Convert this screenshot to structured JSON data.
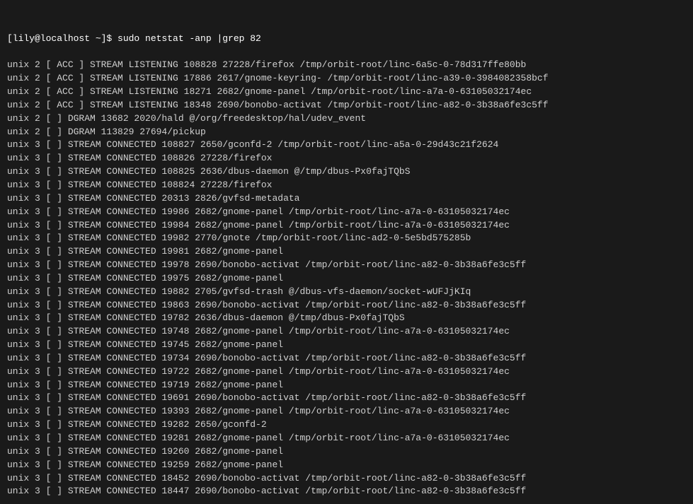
{
  "terminal": {
    "prompt": "[lily@localhost ~]$ sudo netstat -anp |grep 82",
    "rows": [
      {
        "proto": "unix",
        "refcnt": "2",
        "flags": "[ ACC ]",
        "type": "STREAM",
        "state": "LISTENING",
        "inode": "108828",
        "pid_prog": "27228/firefox",
        "path": "/tmp/orbit-root/linc-6a5c-0-78d317ffe80bb"
      },
      {
        "proto": "unix",
        "refcnt": "2",
        "flags": "[ ACC ]",
        "type": "STREAM",
        "state": "LISTENING",
        "inode": "17886",
        "pid_prog": "2617/gnome-keyring-",
        "path": "/tmp/orbit-root/linc-a39-0-3984082358bcf"
      },
      {
        "proto": "unix",
        "refcnt": "2",
        "flags": "[ ACC ]",
        "type": "STREAM",
        "state": "LISTENING",
        "inode": "18271",
        "pid_prog": "2682/gnome-panel",
        "path": "/tmp/orbit-root/linc-a7a-0-63105032174ec"
      },
      {
        "proto": "unix",
        "refcnt": "2",
        "flags": "[ ACC ]",
        "type": "STREAM",
        "state": "LISTENING",
        "inode": "18348",
        "pid_prog": "2690/bonobo-activat",
        "path": "/tmp/orbit-root/linc-a82-0-3b38a6fe3c5ff"
      },
      {
        "proto": "unix",
        "refcnt": "2",
        "flags": "[  ]",
        "type": "DGRAM",
        "state": "",
        "inode": "13682",
        "pid_prog": "2020/hald",
        "path": "@/org/freedesktop/hal/udev_event"
      },
      {
        "proto": "unix",
        "refcnt": "2",
        "flags": "[  ]",
        "type": "DGRAM",
        "state": "",
        "inode": "113829",
        "pid_prog": "27694/pickup",
        "path": ""
      },
      {
        "proto": "unix",
        "refcnt": "3",
        "flags": "[  ]",
        "type": "STREAM",
        "state": "CONNECTED",
        "inode": "108827",
        "pid_prog": "2650/gconfd-2",
        "path": "/tmp/orbit-root/linc-a5a-0-29d43c21f2624"
      },
      {
        "proto": "unix",
        "refcnt": "3",
        "flags": "[  ]",
        "type": "STREAM",
        "state": "CONNECTED",
        "inode": "108826",
        "pid_prog": "27228/firefox",
        "path": ""
      },
      {
        "proto": "unix",
        "refcnt": "3",
        "flags": "[  ]",
        "type": "STREAM",
        "state": "CONNECTED",
        "inode": "108825",
        "pid_prog": "2636/dbus-daemon",
        "path": "@/tmp/dbus-Px0fajTQbS"
      },
      {
        "proto": "unix",
        "refcnt": "3",
        "flags": "[  ]",
        "type": "STREAM",
        "state": "CONNECTED",
        "inode": "108824",
        "pid_prog": "27228/firefox",
        "path": ""
      },
      {
        "proto": "unix",
        "refcnt": "3",
        "flags": "[  ]",
        "type": "STREAM",
        "state": "CONNECTED",
        "inode": "20313",
        "pid_prog": "2826/gvfsd-metadata",
        "path": ""
      },
      {
        "proto": "unix",
        "refcnt": "3",
        "flags": "[  ]",
        "type": "STREAM",
        "state": "CONNECTED",
        "inode": "19986",
        "pid_prog": "2682/gnome-panel",
        "path": "/tmp/orbit-root/linc-a7a-0-63105032174ec"
      },
      {
        "proto": "unix",
        "refcnt": "3",
        "flags": "[  ]",
        "type": "STREAM",
        "state": "CONNECTED",
        "inode": "19984",
        "pid_prog": "2682/gnome-panel",
        "path": "/tmp/orbit-root/linc-a7a-0-63105032174ec"
      },
      {
        "proto": "unix",
        "refcnt": "3",
        "flags": "[  ]",
        "type": "STREAM",
        "state": "CONNECTED",
        "inode": "19982",
        "pid_prog": "2770/gnote",
        "path": "/tmp/orbit-root/linc-ad2-0-5e5bd575285b"
      },
      {
        "proto": "unix",
        "refcnt": "3",
        "flags": "[  ]",
        "type": "STREAM",
        "state": "CONNECTED",
        "inode": "19981",
        "pid_prog": "2682/gnome-panel",
        "path": ""
      },
      {
        "proto": "unix",
        "refcnt": "3",
        "flags": "[  ]",
        "type": "STREAM",
        "state": "CONNECTED",
        "inode": "19978",
        "pid_prog": "2690/bonobo-activat",
        "path": "/tmp/orbit-root/linc-a82-0-3b38a6fe3c5ff"
      },
      {
        "proto": "unix",
        "refcnt": "3",
        "flags": "[  ]",
        "type": "STREAM",
        "state": "CONNECTED",
        "inode": "19975",
        "pid_prog": "2682/gnome-panel",
        "path": ""
      },
      {
        "proto": "unix",
        "refcnt": "3",
        "flags": "[  ]",
        "type": "STREAM",
        "state": "CONNECTED",
        "inode": "19882",
        "pid_prog": "2705/gvfsd-trash",
        "path": "@/dbus-vfs-daemon/socket-wUFJjKIq"
      },
      {
        "proto": "unix",
        "refcnt": "3",
        "flags": "[  ]",
        "type": "STREAM",
        "state": "CONNECTED",
        "inode": "19863",
        "pid_prog": "2690/bonobo-activat",
        "path": "/tmp/orbit-root/linc-a82-0-3b38a6fe3c5ff"
      },
      {
        "proto": "unix",
        "refcnt": "3",
        "flags": "[  ]",
        "type": "STREAM",
        "state": "CONNECTED",
        "inode": "19782",
        "pid_prog": "2636/dbus-daemon",
        "path": "@/tmp/dbus-Px0fajTQbS"
      },
      {
        "proto": "unix",
        "refcnt": "3",
        "flags": "[  ]",
        "type": "STREAM",
        "state": "CONNECTED",
        "inode": "19748",
        "pid_prog": "2682/gnome-panel",
        "path": "/tmp/orbit-root/linc-a7a-0-63105032174ec"
      },
      {
        "proto": "unix",
        "refcnt": "3",
        "flags": "[  ]",
        "type": "STREAM",
        "state": "CONNECTED",
        "inode": "19745",
        "pid_prog": "2682/gnome-panel",
        "path": ""
      },
      {
        "proto": "unix",
        "refcnt": "3",
        "flags": "[  ]",
        "type": "STREAM",
        "state": "CONNECTED",
        "inode": "19734",
        "pid_prog": "2690/bonobo-activat",
        "path": "/tmp/orbit-root/linc-a82-0-3b38a6fe3c5ff"
      },
      {
        "proto": "unix",
        "refcnt": "3",
        "flags": "[  ]",
        "type": "STREAM",
        "state": "CONNECTED",
        "inode": "19722",
        "pid_prog": "2682/gnome-panel",
        "path": "/tmp/orbit-root/linc-a7a-0-63105032174ec"
      },
      {
        "proto": "unix",
        "refcnt": "3",
        "flags": "[  ]",
        "type": "STREAM",
        "state": "CONNECTED",
        "inode": "19719",
        "pid_prog": "2682/gnome-panel",
        "path": ""
      },
      {
        "proto": "unix",
        "refcnt": "3",
        "flags": "[  ]",
        "type": "STREAM",
        "state": "CONNECTED",
        "inode": "19691",
        "pid_prog": "2690/bonobo-activat",
        "path": "/tmp/orbit-root/linc-a82-0-3b38a6fe3c5ff"
      },
      {
        "proto": "unix",
        "refcnt": "3",
        "flags": "[  ]",
        "type": "STREAM",
        "state": "CONNECTED",
        "inode": "19393",
        "pid_prog": "2682/gnome-panel",
        "path": "/tmp/orbit-root/linc-a7a-0-63105032174ec"
      },
      {
        "proto": "unix",
        "refcnt": "3",
        "flags": "[  ]",
        "type": "STREAM",
        "state": "CONNECTED",
        "inode": "19282",
        "pid_prog": "2650/gconfd-2",
        "path": ""
      },
      {
        "proto": "unix",
        "refcnt": "3",
        "flags": "[  ]",
        "type": "STREAM",
        "state": "CONNECTED",
        "inode": "19281",
        "pid_prog": "2682/gnome-panel",
        "path": "/tmp/orbit-root/linc-a7a-0-63105032174ec"
      },
      {
        "proto": "unix",
        "refcnt": "3",
        "flags": "[  ]",
        "type": "STREAM",
        "state": "CONNECTED",
        "inode": "19260",
        "pid_prog": "2682/gnome-panel",
        "path": ""
      },
      {
        "proto": "unix",
        "refcnt": "3",
        "flags": "[  ]",
        "type": "STREAM",
        "state": "CONNECTED",
        "inode": "19259",
        "pid_prog": "2682/gnome-panel",
        "path": ""
      },
      {
        "proto": "unix",
        "refcnt": "3",
        "flags": "[  ]",
        "type": "STREAM",
        "state": "CONNECTED",
        "inode": "18452",
        "pid_prog": "2690/bonobo-activat",
        "path": "/tmp/orbit-root/linc-a82-0-3b38a6fe3c5ff"
      },
      {
        "proto": "unix",
        "refcnt": "3",
        "flags": "[  ]",
        "type": "STREAM",
        "state": "CONNECTED",
        "inode": "18447",
        "pid_prog": "2690/bonobo-activat",
        "path": "/tmp/orbit-root/linc-a82-0-3b38a6fe3c5ff"
      }
    ]
  }
}
